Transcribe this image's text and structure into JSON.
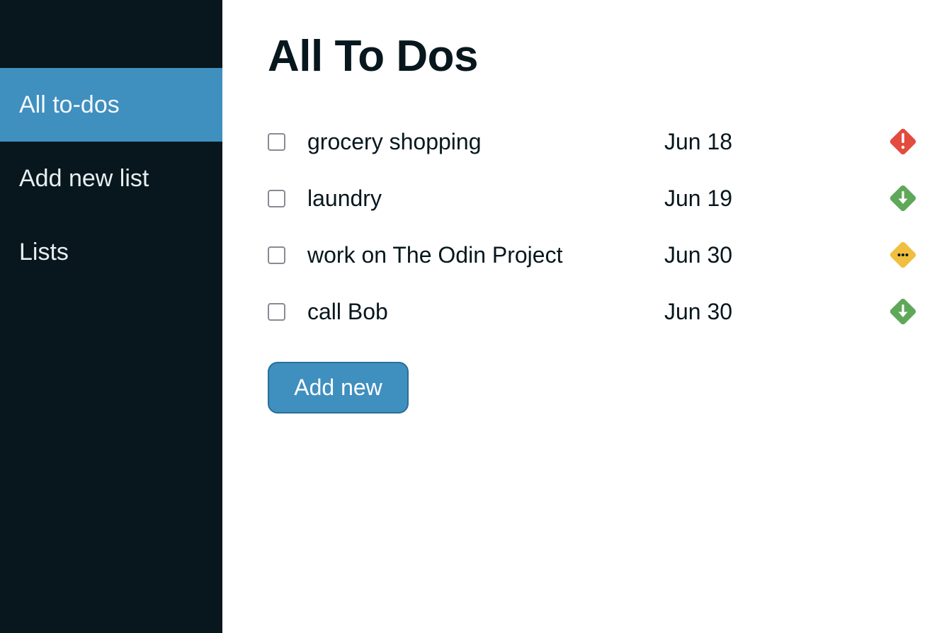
{
  "sidebar": {
    "items": [
      {
        "label": "All to-dos",
        "active": true
      },
      {
        "label": "Add new list",
        "active": false
      },
      {
        "label": "Lists",
        "active": false
      }
    ]
  },
  "main": {
    "title": "All To Dos",
    "todos": [
      {
        "text": "grocery shopping",
        "date": "Jun 18",
        "priority_icon": "exclamation-diamond-icon",
        "priority_color": "#e34b3f"
      },
      {
        "text": "laundry",
        "date": "Jun 19",
        "priority_icon": "arrow-down-diamond-icon",
        "priority_color": "#5fa85a"
      },
      {
        "text": "work on The Odin Project",
        "date": "Jun 30",
        "priority_icon": "ellipsis-diamond-icon",
        "priority_color": "#f1bf3f"
      },
      {
        "text": "call Bob",
        "date": "Jun 30",
        "priority_icon": "arrow-down-diamond-icon",
        "priority_color": "#5fa85a"
      }
    ],
    "add_button_label": "Add new"
  },
  "colors": {
    "sidebar_bg": "#07171d",
    "accent": "#3f8fbf",
    "high_priority": "#e34b3f",
    "low_priority": "#5fa85a",
    "medium_priority": "#f1bf3f"
  }
}
